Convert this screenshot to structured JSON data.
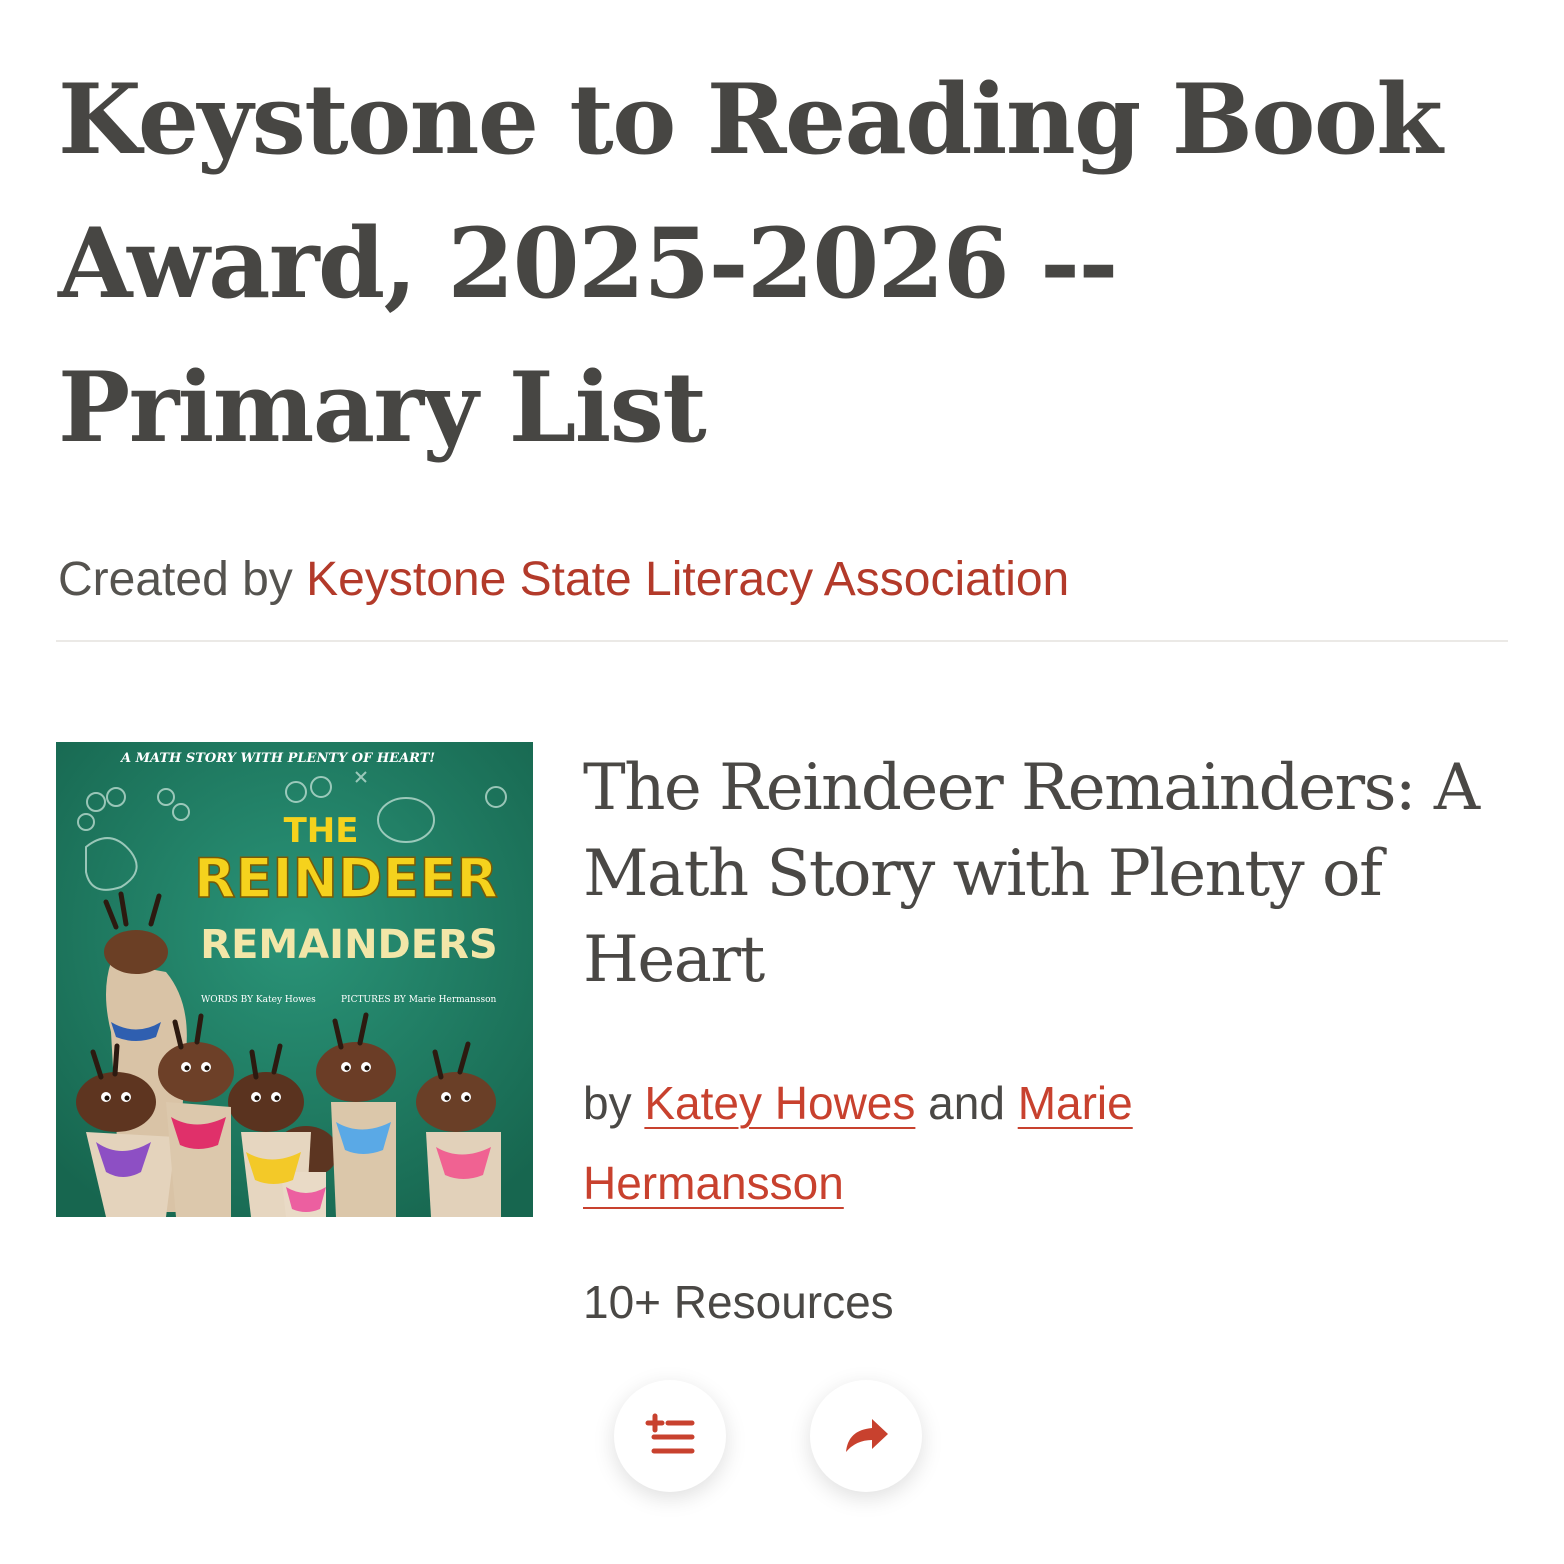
{
  "page": {
    "title": "Keystone to Reading Book Award, 2025-2026 -- Primary List",
    "created_by_prefix": "Created by",
    "creator": "Keystone State Literacy Association"
  },
  "book": {
    "title": "The Reindeer Remainders: A Math Story with Plenty of Heart",
    "by_prefix": "by",
    "author": "Katey Howes",
    "conjunction": "and",
    "illustrator": "Marie Hermansson",
    "resources": "10+ Resources",
    "cover": {
      "tagline": "A MATH STORY WITH PLENTY OF HEART!",
      "title_line1": "THE",
      "title_line2": "REINDEER",
      "title_line3": "REMAINDERS",
      "words_credit": "WORDS BY Katey Howes",
      "pictures_credit": "PICTURES BY Marie Hermansson"
    }
  },
  "actions": {
    "add_to_list_icon": "add-to-list-icon",
    "share_icon": "share-icon"
  },
  "colors": {
    "accent": "#c8412e",
    "creator_link": "#b33a2a",
    "text": "#4a4845",
    "cover_green": "#1e7f67",
    "cover_title_yellow": "#f5d21d"
  }
}
